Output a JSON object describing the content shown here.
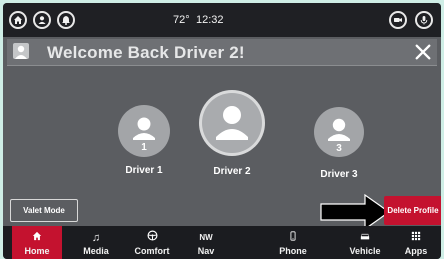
{
  "status": {
    "temperature": "72°",
    "time": "12:32",
    "left_icons": [
      "home-icon",
      "user-icon",
      "bell-icon"
    ],
    "right_icons": [
      "camera-icon",
      "microphone-icon"
    ]
  },
  "header": {
    "title": "Welcome Back Driver 2!"
  },
  "drivers": [
    {
      "label": "Driver 1",
      "seat": "1"
    },
    {
      "label": "Driver 2",
      "seat": ""
    },
    {
      "label": "Driver 3",
      "seat": "3"
    }
  ],
  "buttons": {
    "valet": "Valet Mode",
    "delete": "Delete Profile"
  },
  "nav": [
    {
      "label": "Home",
      "icon": "home-icon",
      "active": true
    },
    {
      "label": "Media",
      "icon": "music-note-icon"
    },
    {
      "label": "Comfort",
      "icon": "steering-icon"
    },
    {
      "label": "Nav",
      "icon": "compass-icon",
      "icon_text": "NW"
    },
    {
      "label": "Phone",
      "icon": "phone-icon"
    },
    {
      "label": "Vehicle",
      "icon": "car-icon"
    },
    {
      "label": "Apps",
      "icon": "apps-grid-icon"
    }
  ],
  "colors": {
    "accent_red": "#c4122f",
    "background": "#5b5d61",
    "bar": "#1b1c20"
  }
}
